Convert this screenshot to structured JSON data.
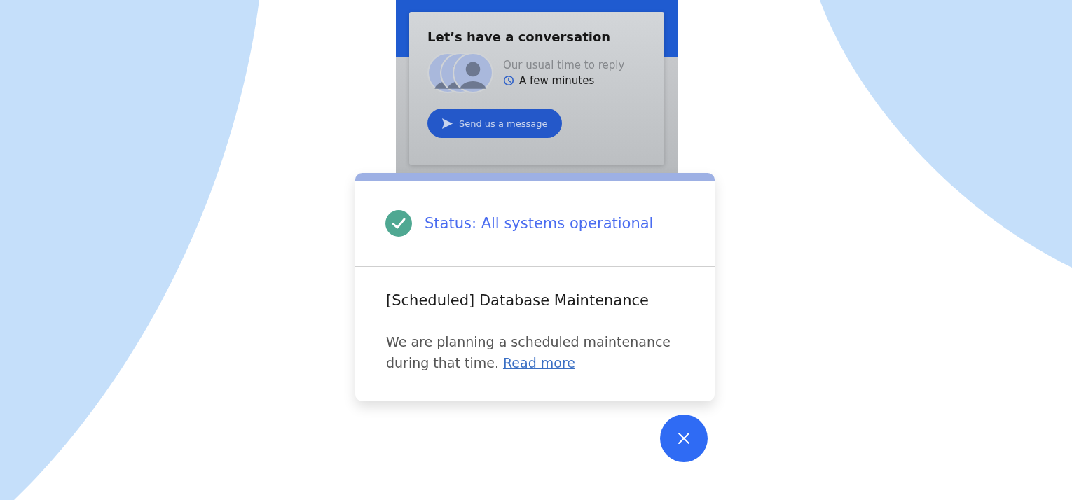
{
  "widget": {
    "title": "Let’s have a conversation",
    "reply_label": "Our usual time to reply",
    "reply_time": "A few minutes",
    "button": "Send us a message"
  },
  "status": {
    "kind": "operational",
    "text": "Status: All systems operational"
  },
  "notice": {
    "title": "[Scheduled] Database Maintenance",
    "body": "We are planning a scheduled maintenance during that time.",
    "link": "Read more"
  },
  "close_button": {
    "kind": "close"
  }
}
